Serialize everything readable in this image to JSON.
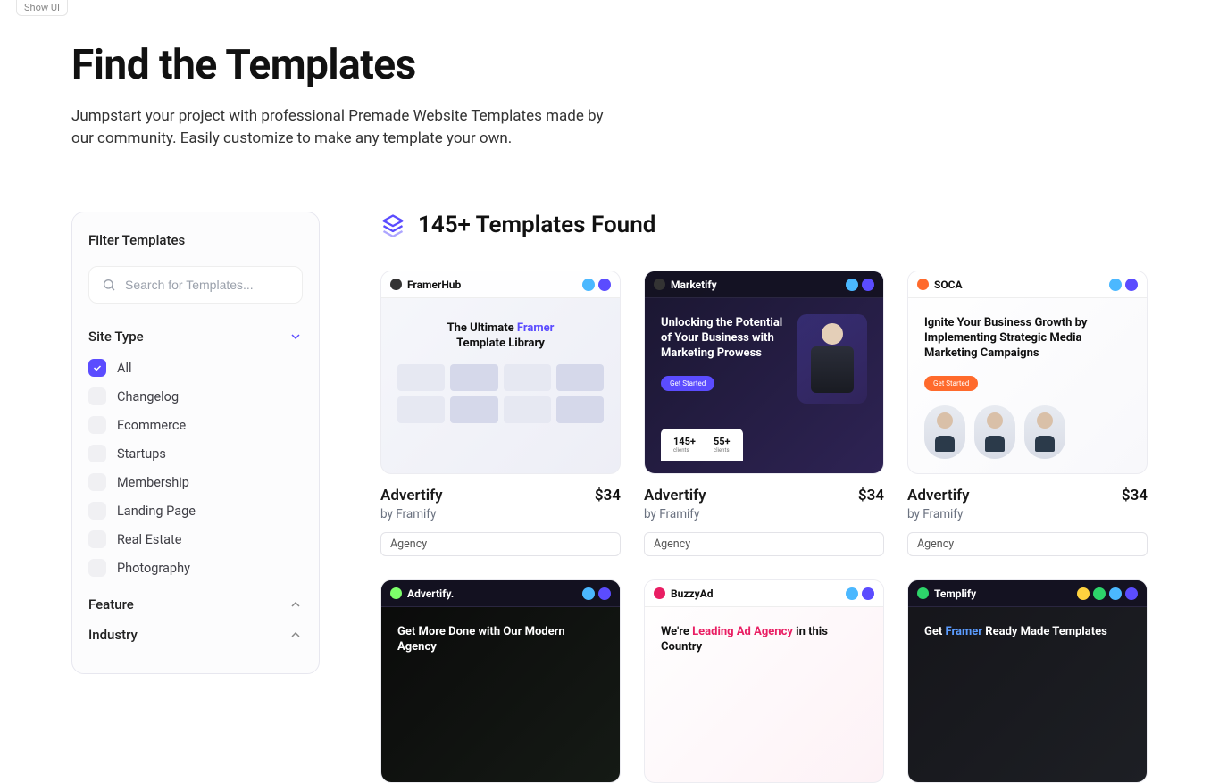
{
  "showUi": "Show UI",
  "hero": {
    "title": "Find the Templates",
    "subtitle": "Jumpstart your project with professional Premade Website Templates made by our community. Easily customize to make any template your own."
  },
  "sidebar": {
    "title": "Filter Templates",
    "searchPlaceholder": "Search for Templates...",
    "groups": [
      {
        "label": "Site Type",
        "expanded": true,
        "options": [
          "All",
          "Changelog",
          "Ecommerce",
          "Startups",
          "Membership",
          "Landing Page",
          "Real Estate",
          "Photography"
        ],
        "checked": "All"
      },
      {
        "label": "Feature",
        "expanded": false
      },
      {
        "label": "Industry",
        "expanded": false
      }
    ]
  },
  "results": {
    "title": "145+ Templates Found"
  },
  "cards": [
    {
      "title": "Advertify",
      "author": "by Framify",
      "price": "$34",
      "tag": "Agency",
      "thumbBrand": "FramerHub",
      "thumbHeadline": "The Ultimate Framer Template Library",
      "thumbVariant": "light"
    },
    {
      "title": "Advertify",
      "author": "by Framify",
      "price": "$34",
      "tag": "Agency",
      "thumbBrand": "Marketify",
      "thumbHeadline": "Unlocking the Potential of Your Business with Marketing Prowess",
      "thumbVariant": "dark",
      "stats": [
        "145+",
        "55+"
      ]
    },
    {
      "title": "Advertify",
      "author": "by Framify",
      "price": "$34",
      "tag": "Agency",
      "thumbBrand": "SOCA",
      "thumbHeadline": "Ignite Your Business Growth by Implementing Strategic Media Marketing Campaigns",
      "thumbVariant": "light3"
    },
    {
      "title": "",
      "author": "",
      "price": "",
      "tag": "",
      "thumbBrand": "Advertify.",
      "thumbHeadline": "Get More Done with Our Modern Agency",
      "thumbVariant": "darkgreen"
    },
    {
      "title": "",
      "author": "",
      "price": "",
      "tag": "",
      "thumbBrand": "BuzzyAd",
      "thumbHeadline": "We're Leading Ad Agency in this Country",
      "thumbVariant": "light2"
    },
    {
      "title": "",
      "author": "",
      "price": "",
      "tag": "",
      "thumbBrand": "Templify",
      "thumbHeadline": "Get Framer Ready Made Templates",
      "thumbVariant": "dark2"
    }
  ]
}
